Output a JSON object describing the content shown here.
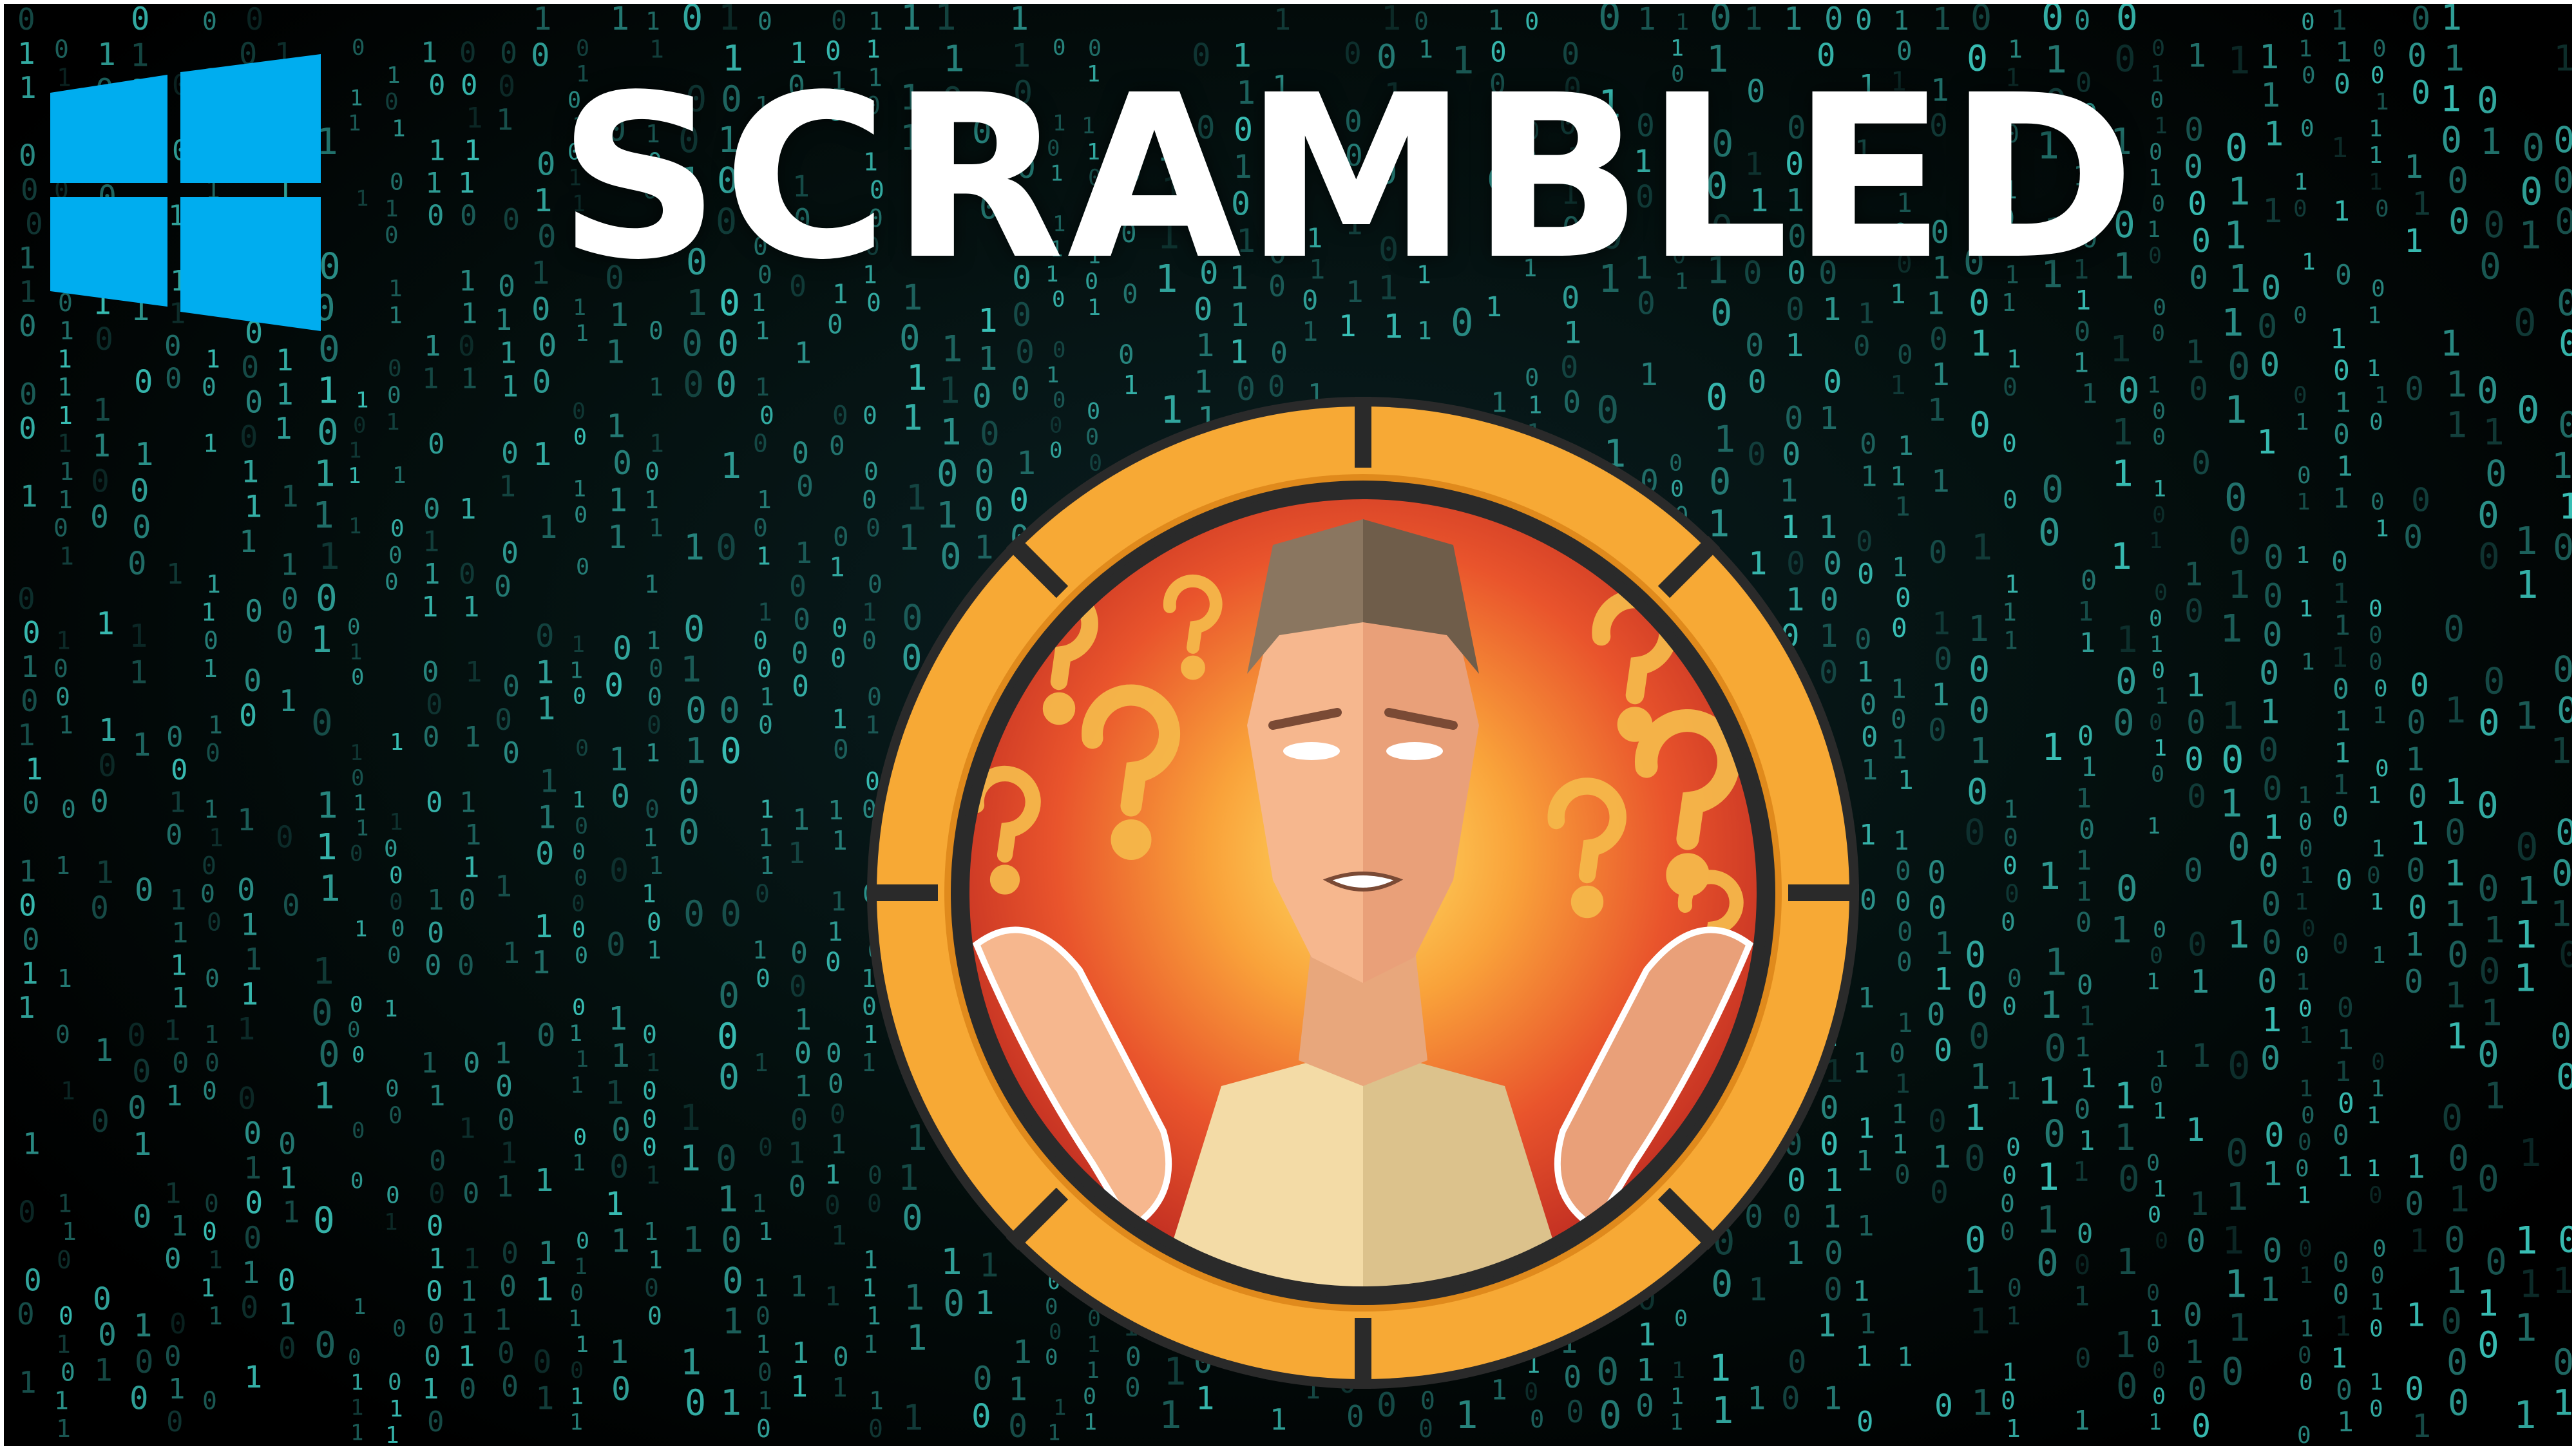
{
  "title": "SCRAMBLED",
  "logo": {
    "icon": "windows-logo-icon",
    "color": "#00adef"
  },
  "badge": {
    "icon": "confused-man-shrug-icon",
    "ring_color": "#f7a935",
    "ring_dark": "#2a2a2a",
    "background_color": "#e8462a",
    "question_mark_color": "#f5b84a"
  },
  "background": {
    "style": "binary-matrix",
    "digit_color": "#3fd3c8",
    "digits": [
      "0",
      "1"
    ]
  }
}
